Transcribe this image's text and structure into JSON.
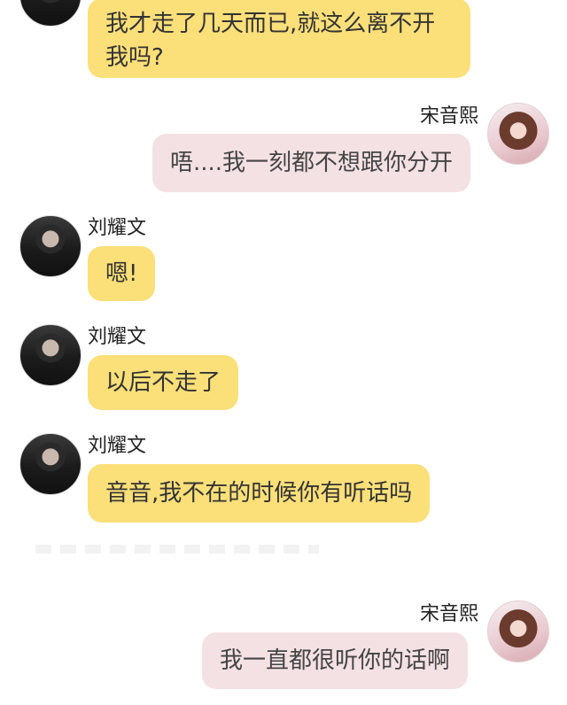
{
  "messages": [
    {
      "speaker": "",
      "text": "我才走了几天而已,就这么离不开我吗?"
    },
    {
      "speaker": "宋音熙",
      "text": "唔....我一刻都不想跟你分开"
    },
    {
      "speaker": "刘耀文",
      "text": "嗯!"
    },
    {
      "speaker": "刘耀文",
      "text": "以后不走了"
    },
    {
      "speaker": "刘耀文",
      "text": "音音,我不在的时候你有听话吗"
    },
    {
      "speaker": "宋音熙",
      "text": "我一直都很听你的话啊"
    }
  ],
  "colors": {
    "left_bubble": "#fbdf79",
    "right_bubble": "#f4e1e4"
  }
}
